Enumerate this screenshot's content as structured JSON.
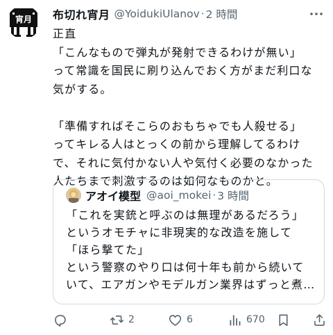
{
  "post": {
    "author": {
      "display_name": "布切れ宵月",
      "handle": "@YoidukiUlanov",
      "separator": "·",
      "time": "2 時間",
      "avatar_text": "宵月"
    },
    "body_lines": [
      "正直",
      "「こんなもので弾丸が発射できるわけが無い」",
      "って常識を国民に刷り込んでおく方がまだ利口な",
      "気がする。",
      "",
      "「準備すればそこらのおもちゃでも人殺せる」",
      "ってキレる人はとっくの前から理解してるわけ",
      "で、それに気付かない人や気付く必要のなかった",
      "人たちまで刺激するのは如何なものかと。"
    ],
    "quote": {
      "display_name": "アオイ模型",
      "handle": "@aoi_mokei",
      "separator": "·",
      "time": "3 時間",
      "lines": [
        "「これを実銃と呼ぶのは無理があるだろう」",
        "というオモチャに非現実的な改造を施して",
        "「ほら撃てた」",
        "という警察のやり口は何十年も前から続いて",
        "いて、エアガンやモデルガン業界はずっと煮…"
      ]
    },
    "actions": {
      "reply_count": "",
      "retweet_count": "2",
      "like_count": "6",
      "views_count": "670"
    },
    "icons": {
      "avatar": "pixel-logo-icon",
      "more": "more-horizontal-icon",
      "reply": "reply-icon",
      "retweet": "retweet-icon",
      "like": "heart-icon",
      "views": "views-icon",
      "bookmark": "bookmark-icon",
      "share": "share-icon"
    },
    "colors": {
      "text": "#0f1419",
      "secondary": "#536471",
      "border": "#cfd9de"
    }
  }
}
